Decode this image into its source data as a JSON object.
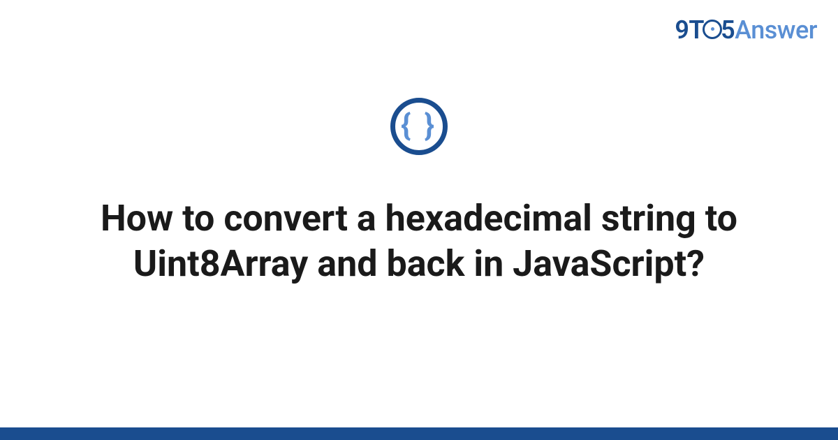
{
  "logo": {
    "part1": "9",
    "part2": "T",
    "part3": "5",
    "part4": "Answer"
  },
  "icon": {
    "glyph": "{ }"
  },
  "title": "How to convert a hexadecimal string to Uint8Array and back in JavaScript?"
}
